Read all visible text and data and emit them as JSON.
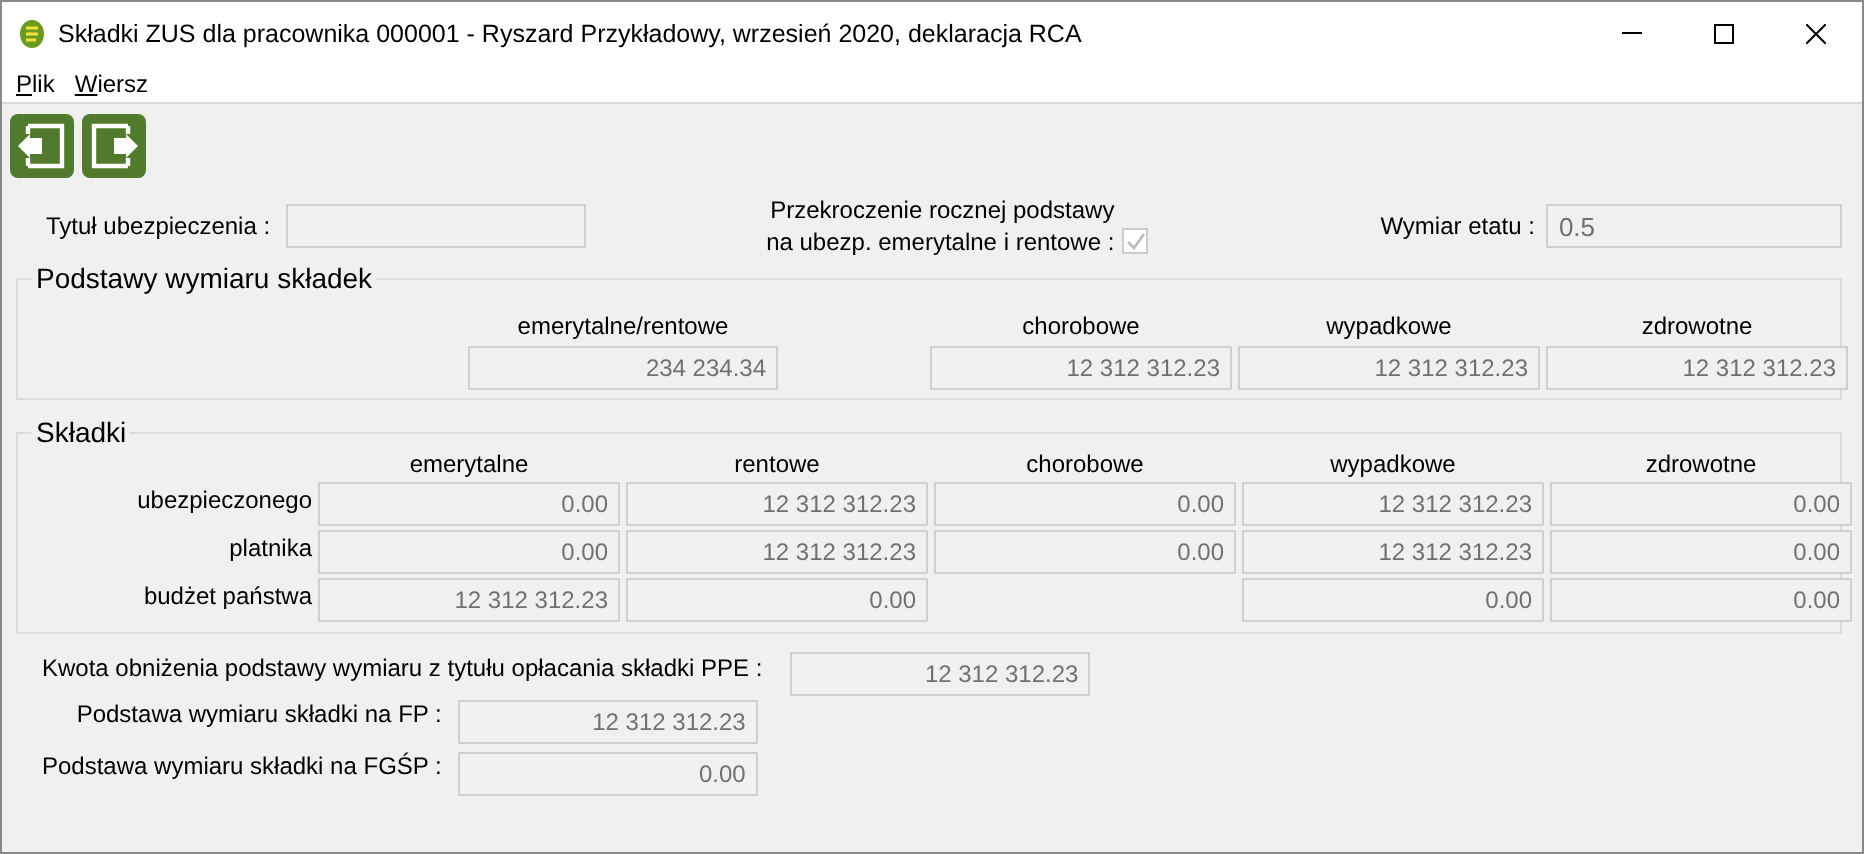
{
  "window": {
    "title": "Składki ZUS dla pracownika 000001 - Ryszard Przykładowy, wrzesień 2020, deklaracja RCA"
  },
  "menu": [
    {
      "label": "Plik"
    },
    {
      "label": "Wiersz"
    }
  ],
  "toolbar": [
    {
      "kind": "prev"
    },
    {
      "kind": "next"
    }
  ],
  "header": {
    "insurance_title": {
      "label": "Tytuł ubezpieczenia :"
    },
    "exceeded": {
      "label_lines": [
        "Przekroczenie rocznej podstawy",
        "na ubezp. emerytalne i rentowe :"
      ],
      "checked": true,
      "disabled": true
    },
    "work_time": {
      "label": "Wymiar etatu :",
      "value": "0.5"
    }
  },
  "bases": {
    "title": "Podstawy wymiaru składek",
    "fields": [
      {
        "label": "emerytalne/rentowe",
        "value": "234 234.34"
      },
      {
        "label": "chorobowe",
        "value": "12 312 312.23"
      },
      {
        "label": "wypadkowe",
        "value": "12 312 312.23"
      },
      {
        "label": "zdrowotne",
        "value": "12 312 312.23"
      }
    ]
  },
  "contributions": {
    "title": "Składki",
    "columns": [
      "emerytalne",
      "rentowe",
      "chorobowe",
      "wypadkowe",
      "zdrowotne"
    ],
    "rows": [
      {
        "label": "ubezpieczonego",
        "cells": [
          "0.00",
          "12 312 312.23",
          "0.00",
          "12 312 312.23",
          "0.00"
        ]
      },
      {
        "label": "platnika",
        "cells": [
          "0.00",
          "12 312 312.23",
          "0.00",
          "12 312 312.23",
          "0.00"
        ]
      },
      {
        "label": "budżet państwa",
        "cells": [
          "12 312 312.23",
          "0.00",
          null,
          "0.00",
          "0.00"
        ]
      }
    ]
  },
  "ppe": {
    "label": "Kwota obniżenia podstawy wymiaru z tytułu opłacania składki PPE :",
    "value": "12 312 312.23"
  },
  "extra": [
    {
      "label": "Podstawa wymiaru składki na FP :",
      "value": "12 312 312.23"
    },
    {
      "label": "Podstawa wymiaru składki na FGŚP :",
      "value": "0.00"
    }
  ]
}
